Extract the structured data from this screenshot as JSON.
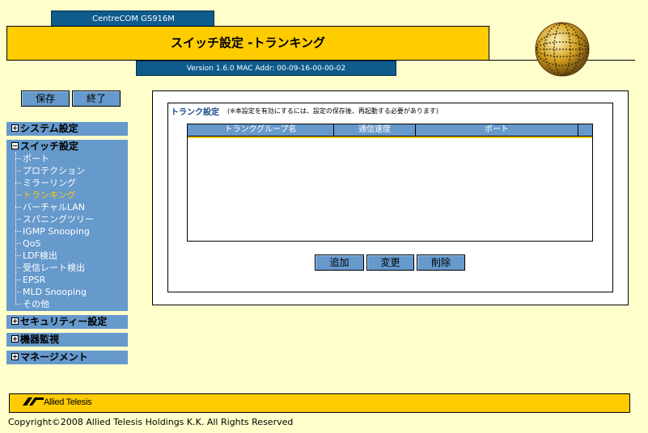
{
  "header": {
    "product": "CentreCOM GS916M",
    "title": "スイッチ設定 -トランキング",
    "version": "Version 1.6.0 MAC Addr: 00-09-16-00-00-02"
  },
  "toolbar": {
    "save_label": "保存",
    "exit_label": "終了"
  },
  "sidebar": {
    "system": "システム設定",
    "switch": "スイッチ設定",
    "items": [
      "ポート",
      "プロテクション",
      "ミラーリング",
      "トランキング",
      "バーチャルLAN",
      "スパニングツリー",
      "IGMP Snooping",
      "QoS",
      "LDF検出",
      "受信レート検出",
      "EPSR",
      "MLD Snooping",
      "その他"
    ],
    "active_item": "トランキング",
    "security": "セキュリティー設定",
    "monitor": "機器監視",
    "management": "マネージメント"
  },
  "trunk": {
    "title": "トランク設定",
    "note": "(※本設定を有効にするには、設定の保存後、再起動する必要があります)",
    "columns": [
      "トランクグループ名",
      "通信速度",
      "ポート"
    ],
    "rows": [],
    "add_label": "追加",
    "edit_label": "変更",
    "delete_label": "削除"
  },
  "footer": {
    "logo": "Allied Telesis",
    "copyright": "Copyright©2008 Allied Telesis Holdings K.K. All Rights Reserved"
  },
  "colors": {
    "accent": "#ffcc00",
    "nav": "#6699cc",
    "header_blue": "#0e5b8c",
    "background": "#ffffcc"
  }
}
